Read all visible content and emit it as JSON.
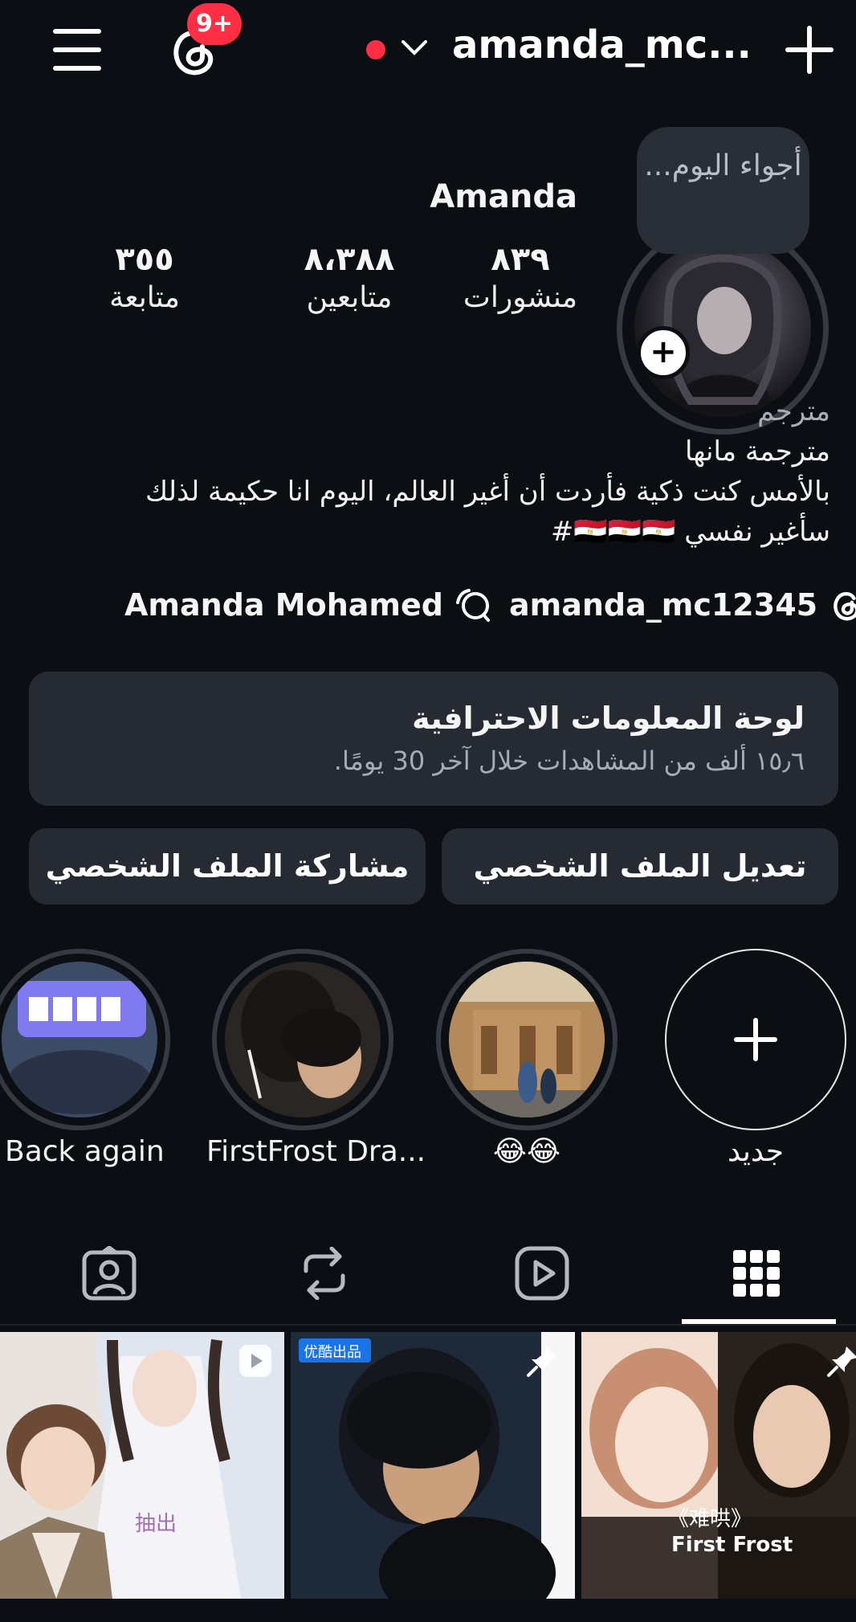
{
  "header": {
    "notification_badge": "9+",
    "username": "amanda_mc...",
    "icons": [
      "menu-icon",
      "threads-icon",
      "chevron-down-icon",
      "plus-icon"
    ],
    "live_dot_color": "#ff2e45"
  },
  "profile": {
    "note": "أجواء اليوم...",
    "name": "Amanda",
    "stats": [
      {
        "num": "٨٣٩",
        "label": "منشورات"
      },
      {
        "num": "٨،٣٨٨",
        "label": "متابعين"
      },
      {
        "num": "٣٥٥",
        "label": "متابعة"
      }
    ],
    "bio": {
      "category": "مترجم",
      "line1": "مترجمة مانها",
      "line2": "بالأمس كنت ذكية فأردت أن أغير العالم، اليوم انا حكيمة لذلك",
      "line3": "سأغير نفسي 🇪🇬🇪🇬🇪🇬#"
    },
    "links": {
      "threads_handle": "amanda_mc12345",
      "channel_name": "Amanda Mohamed"
    }
  },
  "dashboard": {
    "title": "لوحة المعلومات الاحترافية",
    "subtitle": "١٥٫٦ ألف من المشاهدات خلال آخر 30 يومًا."
  },
  "buttons": {
    "edit_profile": "تعديل الملف الشخصي",
    "share_profile": "مشاركة الملف الشخصي"
  },
  "highlights": [
    {
      "label": "جديد"
    },
    {
      "label": "😂😂"
    },
    {
      "label": "FirstFrost Dra..."
    },
    {
      "label": "Back again"
    }
  ],
  "tabs": [
    "grid-icon",
    "reels-icon",
    "reposts-icon",
    "tagged-icon"
  ],
  "grid": {
    "captions": [
      "抽出",
      "优酷出品",
      "《难哄》",
      "First Frost"
    ]
  }
}
